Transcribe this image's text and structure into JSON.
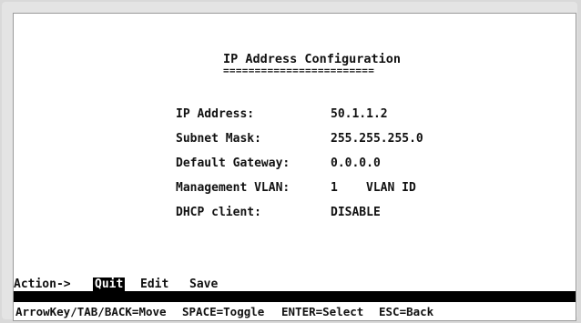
{
  "screen": {
    "title": "IP Address Configuration",
    "title_underline": "========================"
  },
  "fields": [
    {
      "label": "IP Address:",
      "value": "50.1.1.2"
    },
    {
      "label": "Subnet Mask:",
      "value": "255.255.255.0"
    },
    {
      "label": "Default Gateway:",
      "value": "0.0.0.0"
    },
    {
      "label": "Management VLAN:",
      "value": "1",
      "unit": "VLAN ID"
    },
    {
      "label": "DHCP client:",
      "value": "DISABLE"
    }
  ],
  "action_bar": {
    "label": "Action->",
    "items": [
      "Quit",
      "Edit",
      "Save"
    ],
    "selected": "Quit"
  },
  "hints": [
    "ArrowKey/TAB/BACK=Move",
    "SPACE=Toggle",
    "ENTER=Select",
    "ESC=Back"
  ],
  "colors": {
    "background": "#ffffff",
    "text": "#111111",
    "highlight_bg": "#000000",
    "highlight_fg": "#ffffff"
  }
}
